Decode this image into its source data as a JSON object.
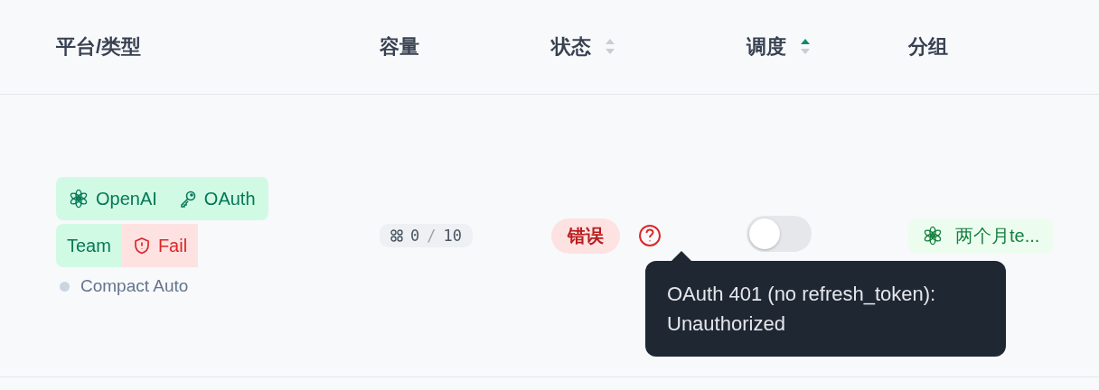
{
  "table": {
    "columns": [
      {
        "label": "平台/类型"
      },
      {
        "label": "容量"
      },
      {
        "label": "状态",
        "sort_ascending": false
      },
      {
        "label": "调度",
        "sort_ascending": true
      },
      {
        "label": "分组"
      }
    ],
    "rows": [
      {
        "platform": "OpenAI",
        "auth": "OAuth",
        "plan": "Team",
        "plan_status": {
          "label": "Fail",
          "kind": "danger"
        },
        "mode": "Compact Auto",
        "capacity": {
          "used": "0",
          "sep": "/",
          "total": "10"
        },
        "status": {
          "label": "错误",
          "kind": "error"
        },
        "schedule": {
          "on": false
        },
        "group": "两个月te...",
        "tooltip": "OAuth 401 (no refresh_token): Unauthorized"
      }
    ]
  }
}
